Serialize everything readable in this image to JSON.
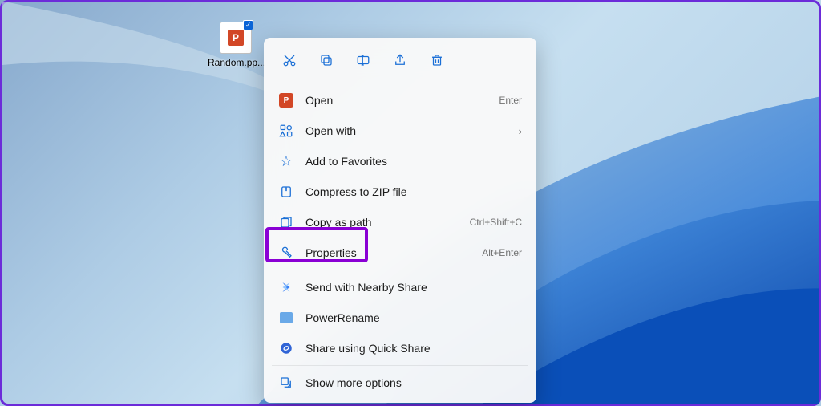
{
  "desktop": {
    "file": {
      "name": "Random.pp...",
      "badge": "P"
    }
  },
  "actionbar": {
    "cut": "cut-icon",
    "copy": "copy-icon",
    "rename": "rename-icon",
    "share": "share-icon",
    "delete": "delete-icon"
  },
  "menu": {
    "open": {
      "label": "Open",
      "hint": "Enter"
    },
    "openWith": {
      "label": "Open with"
    },
    "favorites": {
      "label": "Add to Favorites"
    },
    "compress": {
      "label": "Compress to ZIP file"
    },
    "copyPath": {
      "label": "Copy as path",
      "hint": "Ctrl+Shift+C"
    },
    "properties": {
      "label": "Properties",
      "hint": "Alt+Enter"
    },
    "nearby": {
      "label": "Send with Nearby Share"
    },
    "powerRename": {
      "label": "PowerRename"
    },
    "quickShare": {
      "label": "Share using Quick Share"
    },
    "moreOptions": {
      "label": "Show more options"
    }
  }
}
